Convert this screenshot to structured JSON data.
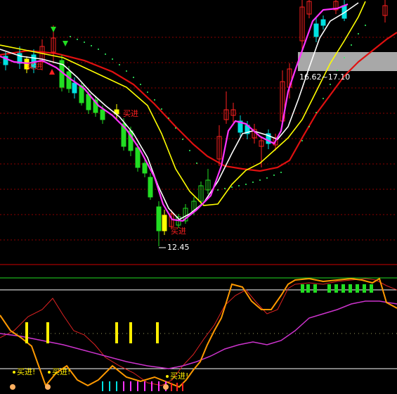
{
  "price_panel": {
    "price_low_label": "12.45",
    "price_range_label": "16.62~17.10",
    "buy_label": "买进"
  },
  "indicator_panel": {
    "buy_signal_label": "买进!"
  },
  "colors": {
    "background": "#000000",
    "grid": "#8b0000",
    "candle_up": "#ff2020",
    "candle_down": "#00e1e1",
    "candle_green": "#22dd22",
    "ma_white": "#ffffff",
    "ma_yellow": "#ffff00",
    "ma_magenta": "#ff33ff",
    "ma_red": "#e01010",
    "sar_dots": "#33ff66",
    "osc_orange": "#ff9900",
    "osc_magenta": "#cc33cc",
    "signal_yellow": "#ffee00",
    "highlight_band": "#a8a8a8"
  }
}
